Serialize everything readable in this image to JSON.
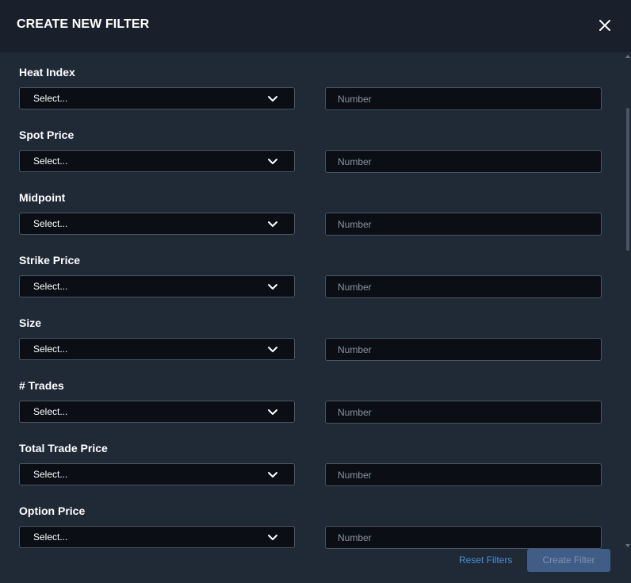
{
  "dialog": {
    "title": "CREATE NEW FILTER",
    "close_icon": "close-icon"
  },
  "colors": {
    "header_bg": "#19202b",
    "body_bg": "#202936",
    "field_bg": "#0b0f15",
    "field_border": "#4b5563",
    "link": "#4a90d9",
    "primary_disabled": "#3f5d86"
  },
  "filters": [
    {
      "label": "Heat Index",
      "select_value": "Select...",
      "number_placeholder": "Number"
    },
    {
      "label": "Spot Price",
      "select_value": "Select...",
      "number_placeholder": "Number"
    },
    {
      "label": "Midpoint",
      "select_value": "Select...",
      "number_placeholder": "Number"
    },
    {
      "label": "Strike Price",
      "select_value": "Select...",
      "number_placeholder": "Number"
    },
    {
      "label": "Size",
      "select_value": "Select...",
      "number_placeholder": "Number"
    },
    {
      "label": "# Trades",
      "select_value": "Select...",
      "number_placeholder": "Number"
    },
    {
      "label": "Total Trade Price",
      "select_value": "Select...",
      "number_placeholder": "Number"
    },
    {
      "label": "Option Price",
      "select_value": "Select...",
      "number_placeholder": "Number"
    }
  ],
  "footer": {
    "reset_label": "Reset Filters",
    "create_label": "Create Filter"
  }
}
